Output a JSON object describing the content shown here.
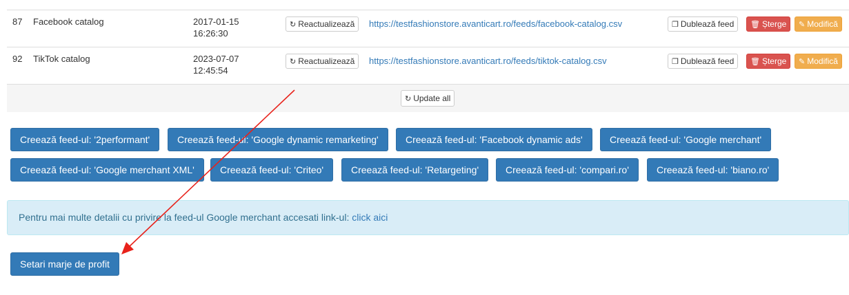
{
  "rows": [
    {
      "id": "87",
      "name": "Facebook catalog",
      "date": "2017-01-15",
      "time": "16:26:30",
      "refresh_label": "Reactualizează",
      "url": "https://testfashionstore.avanticart.ro/feeds/facebook-catalog.csv",
      "duplicate_label": "Dublează feed",
      "delete_label": "Șterge",
      "edit_label": "Modifică"
    },
    {
      "id": "92",
      "name": "TikTok catalog",
      "date": "2023-07-07",
      "time": "12:45:54",
      "refresh_label": "Reactualizează",
      "url": "https://testfashionstore.avanticart.ro/feeds/tiktok-catalog.csv",
      "duplicate_label": "Dublează feed",
      "delete_label": "Șterge",
      "edit_label": "Modifică"
    }
  ],
  "update_all_label": "Update all",
  "create_buttons": [
    "Creează feed-ul: '2performant'",
    "Creează feed-ul: 'Google dynamic remarketing'",
    "Creează feed-ul: 'Facebook dynamic ads'",
    "Creează feed-ul: 'Google merchant'",
    "Creează feed-ul: 'Google merchant XML'",
    "Creează feed-ul: 'Criteo'",
    "Creează feed-ul: 'Retargeting'",
    "Creează feed-ul: 'compari.ro'",
    "Creează feed-ul: 'biano.ro'"
  ],
  "info": {
    "text": "Pentru mai multe detalii cu privire la feed-ul Google merchant accesati link-ul: ",
    "link": "click aici"
  },
  "profit_button": "Setari marje de profit",
  "icons": {
    "refresh": "refresh-icon",
    "duplicate": "copy-icon",
    "delete": "trash-icon",
    "edit": "edit-icon"
  },
  "colors": {
    "primary": "#337ab7",
    "danger": "#d9534f",
    "warning": "#f0ad4e",
    "info_bg": "#d9edf7",
    "annotation_arrow": "#e8221b"
  }
}
